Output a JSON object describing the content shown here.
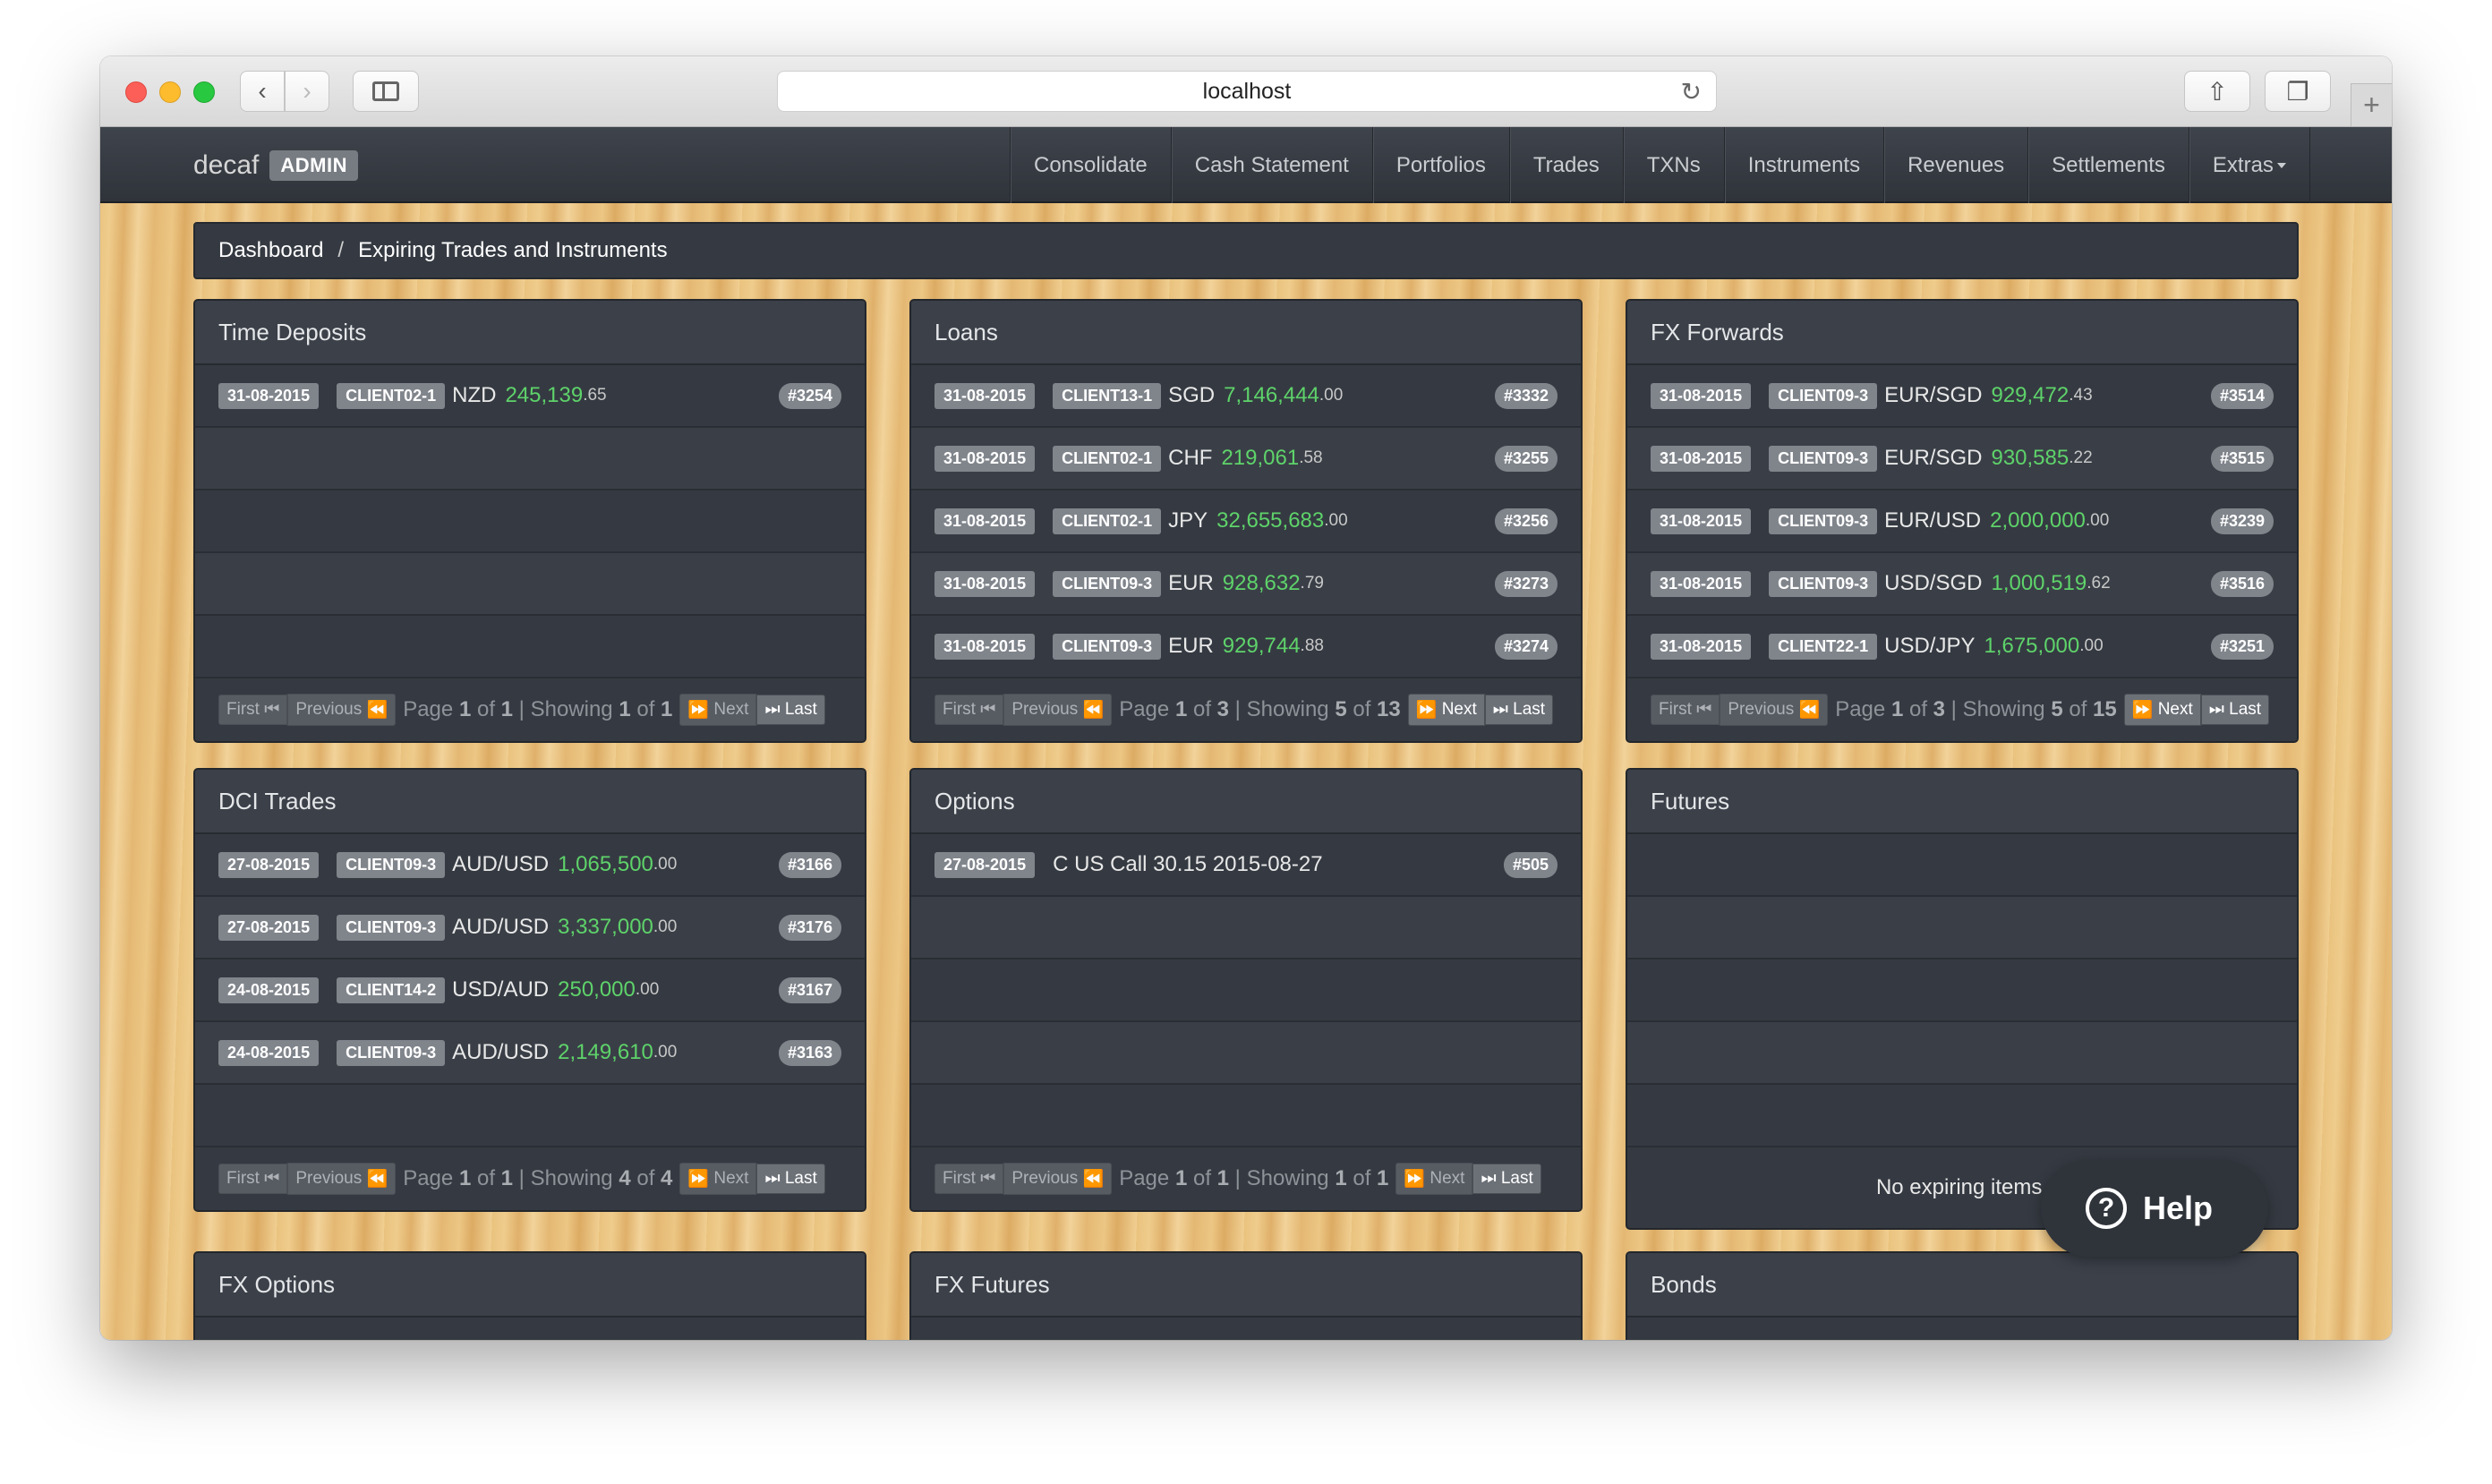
{
  "browser": {
    "url": "localhost"
  },
  "navbar": {
    "brand": "decaf",
    "brand_badge": "ADMIN",
    "items": [
      "Consolidate",
      "Cash Statement",
      "Portfolios",
      "Trades",
      "TXNs",
      "Instruments",
      "Revenues",
      "Settlements",
      "Extras"
    ]
  },
  "breadcrumb": {
    "home": "Dashboard",
    "separator": "/",
    "current": "Expiring Trades and Instruments"
  },
  "pager_labels": {
    "first": "First",
    "previous": "Previous",
    "next": "Next",
    "last": "Last",
    "page": "Page",
    "of": "of",
    "showing": "Showing"
  },
  "panels": {
    "time_deposits": {
      "title": "Time Deposits",
      "rows": [
        {
          "date": "31-08-2015",
          "client": "CLIENT02-1",
          "ccy": "NZD",
          "amount": "245,139",
          "decimals": ".65",
          "id": "#3254"
        }
      ],
      "pager": {
        "page": "1",
        "pages": "1",
        "showing": "1",
        "total": "1"
      }
    },
    "loans": {
      "title": "Loans",
      "rows": [
        {
          "date": "31-08-2015",
          "client": "CLIENT13-1",
          "ccy": "SGD",
          "amount": "7,146,444",
          "decimals": ".00",
          "id": "#3332"
        },
        {
          "date": "31-08-2015",
          "client": "CLIENT02-1",
          "ccy": "CHF",
          "amount": "219,061",
          "decimals": ".58",
          "id": "#3255"
        },
        {
          "date": "31-08-2015",
          "client": "CLIENT02-1",
          "ccy": "JPY",
          "amount": "32,655,683",
          "decimals": ".00",
          "id": "#3256"
        },
        {
          "date": "31-08-2015",
          "client": "CLIENT09-3",
          "ccy": "EUR",
          "amount": "928,632",
          "decimals": ".79",
          "id": "#3273"
        },
        {
          "date": "31-08-2015",
          "client": "CLIENT09-3",
          "ccy": "EUR",
          "amount": "929,744",
          "decimals": ".88",
          "id": "#3274"
        }
      ],
      "pager": {
        "page": "1",
        "pages": "3",
        "showing": "5",
        "total": "13"
      }
    },
    "fx_forwards": {
      "title": "FX Forwards",
      "rows": [
        {
          "date": "31-08-2015",
          "client": "CLIENT09-3",
          "ccy": "EUR/SGD",
          "amount": "929,472",
          "decimals": ".43",
          "id": "#3514"
        },
        {
          "date": "31-08-2015",
          "client": "CLIENT09-3",
          "ccy": "EUR/SGD",
          "amount": "930,585",
          "decimals": ".22",
          "id": "#3515"
        },
        {
          "date": "31-08-2015",
          "client": "CLIENT09-3",
          "ccy": "EUR/USD",
          "amount": "2,000,000",
          "decimals": ".00",
          "id": "#3239"
        },
        {
          "date": "31-08-2015",
          "client": "CLIENT09-3",
          "ccy": "USD/SGD",
          "amount": "1,000,519",
          "decimals": ".62",
          "id": "#3516"
        },
        {
          "date": "31-08-2015",
          "client": "CLIENT22-1",
          "ccy": "USD/JPY",
          "amount": "1,675,000",
          "decimals": ".00",
          "id": "#3251"
        }
      ],
      "pager": {
        "page": "1",
        "pages": "3",
        "showing": "5",
        "total": "15"
      }
    },
    "dci_trades": {
      "title": "DCI Trades",
      "rows": [
        {
          "date": "27-08-2015",
          "client": "CLIENT09-3",
          "ccy": "AUD/USD",
          "amount": "1,065,500",
          "decimals": ".00",
          "id": "#3166"
        },
        {
          "date": "27-08-2015",
          "client": "CLIENT09-3",
          "ccy": "AUD/USD",
          "amount": "3,337,000",
          "decimals": ".00",
          "id": "#3176"
        },
        {
          "date": "24-08-2015",
          "client": "CLIENT14-2",
          "ccy": "USD/AUD",
          "amount": "250,000",
          "decimals": ".00",
          "id": "#3167"
        },
        {
          "date": "24-08-2015",
          "client": "CLIENT09-3",
          "ccy": "AUD/USD",
          "amount": "2,149,610",
          "decimals": ".00",
          "id": "#3163"
        }
      ],
      "pager": {
        "page": "1",
        "pages": "1",
        "showing": "4",
        "total": "4"
      }
    },
    "options": {
      "title": "Options",
      "rows": [
        {
          "date": "27-08-2015",
          "text": "C US Call 30.15 2015-08-27",
          "id": "#505"
        }
      ],
      "pager": {
        "page": "1",
        "pages": "1",
        "showing": "1",
        "total": "1"
      }
    },
    "futures": {
      "title": "Futures",
      "empty_message": "No expiring items."
    },
    "fx_options": {
      "title": "FX Options"
    },
    "fx_futures": {
      "title": "FX Futures"
    },
    "bonds": {
      "title": "Bonds"
    }
  },
  "help": {
    "label": "Help"
  },
  "colors": {
    "amount": "#5ed36a",
    "navbar": "#33373e",
    "panel": "#353a42"
  }
}
